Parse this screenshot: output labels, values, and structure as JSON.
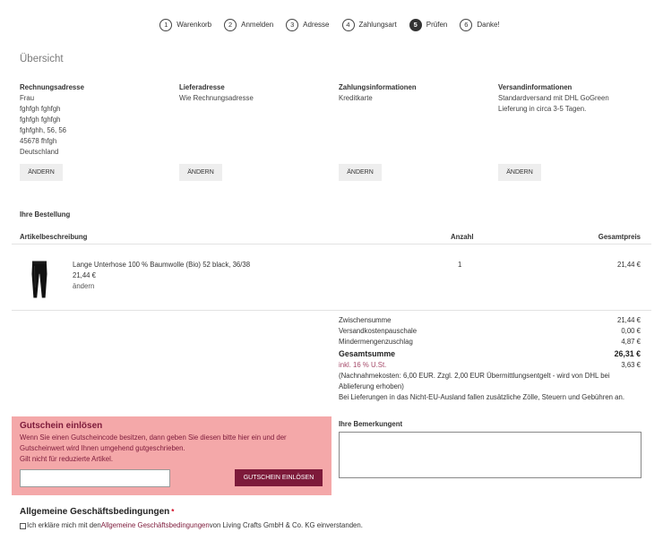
{
  "steps": [
    {
      "number": "1",
      "label": "Warenkorb",
      "active": false
    },
    {
      "number": "2",
      "label": "Anmelden",
      "active": false
    },
    {
      "number": "3",
      "label": "Adresse",
      "active": false
    },
    {
      "number": "4",
      "label": "Zahlungsart",
      "active": false
    },
    {
      "number": "5",
      "label": "Prüfen",
      "active": true
    },
    {
      "number": "6",
      "label": "Danke!",
      "active": false
    }
  ],
  "overview": {
    "title": "Übersicht",
    "columns": [
      {
        "heading": "Rechnungsadresse",
        "lines": [
          "Frau",
          "fghfgh fghfgh",
          "fghfgh fghfgh",
          "fghfghh, 56, 56",
          "45678 fhfgh",
          "Deutschland"
        ],
        "button": "ÄNDERN"
      },
      {
        "heading": "Lieferadresse",
        "lines": [
          "Wie Rechnungsadresse"
        ],
        "button": "ÄNDERN"
      },
      {
        "heading": "Zahlungsinformationen",
        "lines": [
          "Kreditkarte"
        ],
        "button": "ÄNDERN"
      },
      {
        "heading": "Versandinformationen",
        "lines": [
          "Standardversand mit DHL GoGreen",
          "Lieferung in circa 3-5 Tagen."
        ],
        "button": "ÄNDERN"
      }
    ]
  },
  "order": {
    "title": "Ihre Bestellung",
    "headers": {
      "description": "Artikelbeschreibung",
      "quantity": "Anzahl",
      "total": "Gesamtpreis"
    },
    "items": [
      {
        "name": "Lange Unterhose 100 % Baumwolle (Bio) 52 black, 36/38",
        "unit_price": "21,44 €",
        "edit_link": "ändern",
        "quantity": "1",
        "total": "21,44 €"
      }
    ]
  },
  "summary": {
    "rows": [
      {
        "label": "Zwischensumme",
        "value": "21,44 €"
      },
      {
        "label": "Versandkostenpauschale",
        "value": "0,00 €"
      },
      {
        "label": "Mindermengenzuschlag",
        "value": "4,87 €"
      }
    ],
    "total": {
      "label": "Gesamtsumme",
      "value": "26,31 €"
    },
    "tax": {
      "label": "inkl. 16 % U.St.",
      "value": "3,63 €"
    },
    "notes": [
      "(Nachnahmekosten: 6,00 EUR. Zzgl. 2,00 EUR Übermittlungsentgelt - wird von DHL bei Ablieferung erhoben)",
      "Bei Lieferungen in das Nicht-EU-Ausland fallen zusätzliche Zölle, Steuern und Gebühren an."
    ]
  },
  "coupon": {
    "title": "Gutschein einlösen",
    "description": "Wenn Sie einen Gutscheincode besitzen, dann geben Sie diesen bitte hier ein und der Gutscheinwert wird Ihnen umgehend gutgeschrieben.",
    "restriction": "Gilt nicht für reduzierte Artikel.",
    "code_value": "",
    "button": "GUTSCHEIN EINLÖSEN"
  },
  "remarks": {
    "label": "Ihre Bemerkungent",
    "value": ""
  },
  "terms": {
    "heading": "Allgemeine Geschäftsbedingungen",
    "required_marker": "*",
    "checked": false,
    "text_before": "Ich erkläre mich mit den ",
    "link_text": "Allgemeine Geschäftsbedingungen",
    "text_after": " von Living Crafts GmbH & Co. KG einverstanden."
  },
  "colors": {
    "accent": "#7d1a3a",
    "coupon_background": "#f4a8a9",
    "tax_text": "#a64b6a",
    "required_marker": "#d0021b"
  }
}
